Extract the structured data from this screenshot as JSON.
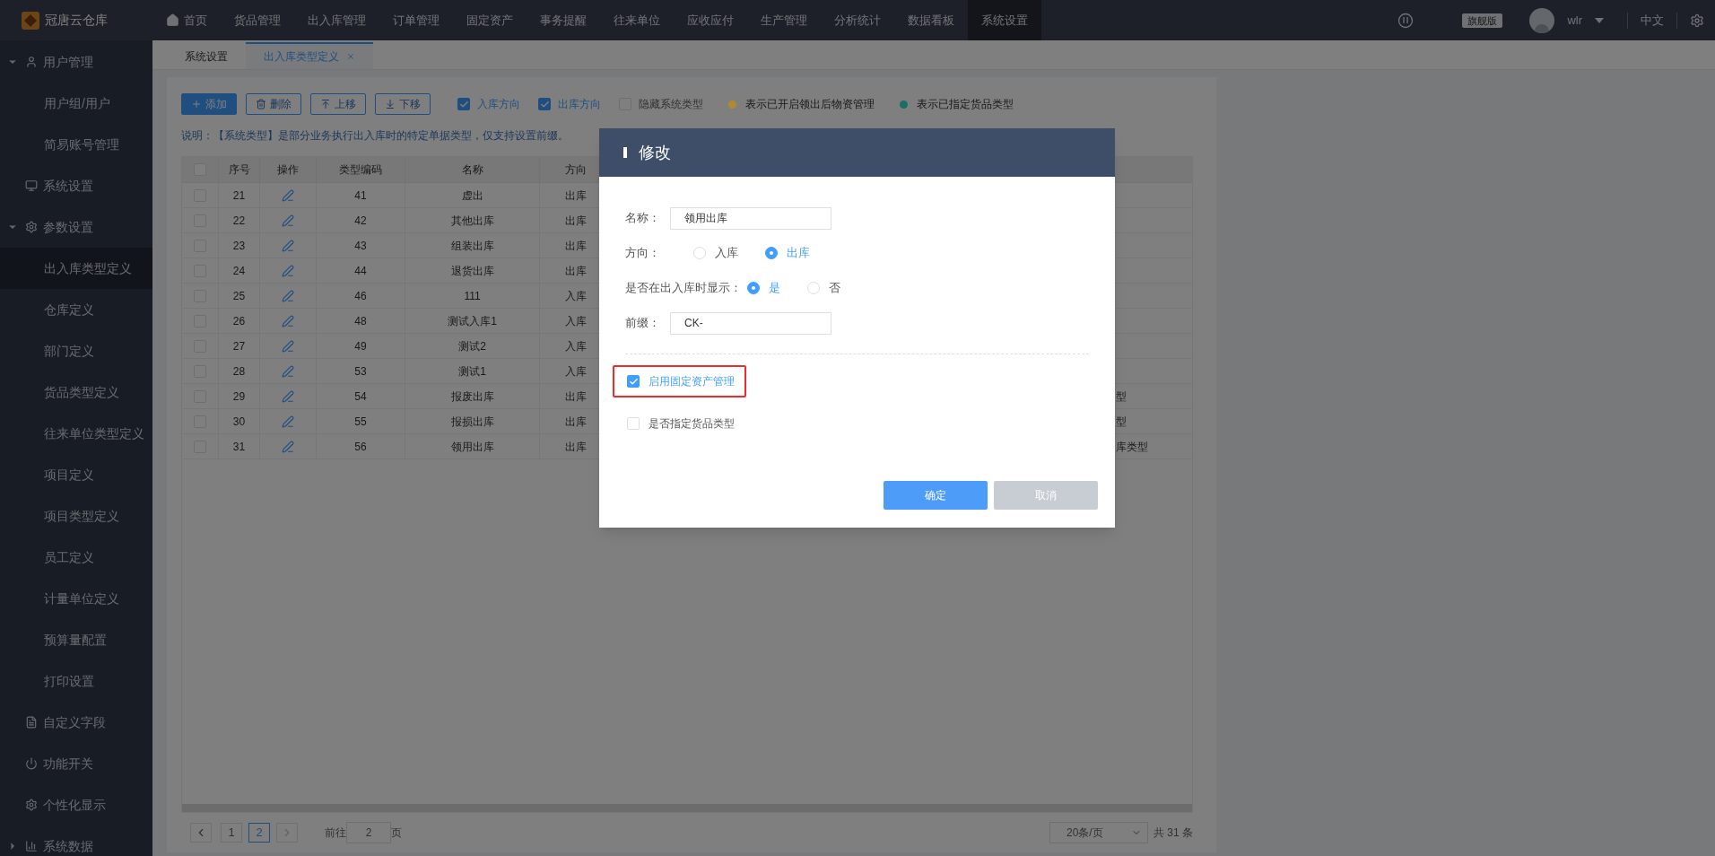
{
  "app": {
    "logo_text": "冠唐云仓库"
  },
  "top_nav": [
    {
      "label": "首页",
      "selected": false
    },
    {
      "label": "货品管理",
      "selected": false
    },
    {
      "label": "出入库管理",
      "selected": false
    },
    {
      "label": "订单管理",
      "selected": false
    },
    {
      "label": "固定资产",
      "selected": false
    },
    {
      "label": "事务提醒",
      "selected": false
    },
    {
      "label": "往来单位",
      "selected": false
    },
    {
      "label": "应收应付",
      "selected": false
    },
    {
      "label": "生产管理",
      "selected": false
    },
    {
      "label": "分析统计",
      "selected": false
    },
    {
      "label": "数据看板",
      "selected": false
    },
    {
      "label": "系统设置",
      "selected": true
    }
  ],
  "user_bar": {
    "edition": "旗舰版",
    "user": "wlr",
    "language": "中文"
  },
  "sidebar": {
    "items": [
      {
        "label": "用户管理",
        "expanded": true,
        "children": [
          {
            "label": "用户组/用户",
            "selected": false
          },
          {
            "label": "简易账号管理",
            "selected": false
          }
        ]
      },
      {
        "label": "系统设置"
      },
      {
        "label": "参数设置",
        "expanded": true,
        "children": [
          {
            "label": "出入库类型定义",
            "selected": true
          },
          {
            "label": "仓库定义",
            "selected": false
          },
          {
            "label": "部门定义",
            "selected": false
          },
          {
            "label": "货品类型定义",
            "selected": false
          },
          {
            "label": "往来单位类型定义",
            "selected": false
          },
          {
            "label": "项目定义",
            "selected": false
          },
          {
            "label": "项目类型定义",
            "selected": false
          },
          {
            "label": "员工定义",
            "selected": false
          },
          {
            "label": "计量单位定义",
            "selected": false
          },
          {
            "label": "预算量配置",
            "selected": false
          },
          {
            "label": "打印设置",
            "selected": false
          }
        ]
      },
      {
        "label": "自定义字段"
      },
      {
        "label": "功能开关"
      },
      {
        "label": "个性化显示"
      },
      {
        "label": "系统数据",
        "expanded": false
      }
    ]
  },
  "tabs": [
    {
      "label": "系统设置",
      "selected": false
    },
    {
      "label": "出入库类型定义",
      "selected": true
    }
  ],
  "toolbar": {
    "buttons": [
      {
        "label": "添加",
        "kind": "primary"
      },
      {
        "label": "删除",
        "kind": "plain"
      },
      {
        "label": "上移",
        "kind": "plain"
      },
      {
        "label": "下移",
        "kind": "plain"
      }
    ],
    "filters": [
      {
        "label": "入库方向",
        "checked": true
      },
      {
        "label": "出库方向",
        "checked": true
      },
      {
        "label": "隐藏系统类型",
        "checked": false
      }
    ],
    "legend": [
      {
        "label": "表示已开启领出后物资管理",
        "color": "#b08a2e"
      },
      {
        "label": "表示已指定货品类型",
        "color": "#1b6e64"
      }
    ]
  },
  "note": "说明：【系统类型】是部分业务执行出入库时的特定单据类型，仅支持设置前缀。",
  "table": {
    "all_checked": false,
    "columns": [
      "序号",
      "操作",
      "类型编码",
      "名称",
      "方向"
    ],
    "rows": [
      {
        "seq": "21",
        "code": "41",
        "name": "虚出",
        "direction": "出库",
        "checked": false
      },
      {
        "seq": "22",
        "code": "42",
        "name": "其他出库",
        "direction": "出库",
        "checked": false
      },
      {
        "seq": "23",
        "code": "43",
        "name": "组装出库",
        "direction": "出库",
        "checked": false
      },
      {
        "seq": "24",
        "code": "44",
        "name": "退货出库",
        "direction": "出库",
        "checked": false
      },
      {
        "seq": "25",
        "code": "46",
        "name": "111",
        "direction": "入库",
        "checked": false
      },
      {
        "seq": "26",
        "code": "48",
        "name": "测试入库1",
        "direction": "入库",
        "checked": false
      },
      {
        "seq": "27",
        "code": "49",
        "name": "测试2",
        "direction": "入库",
        "checked": false
      },
      {
        "seq": "28",
        "code": "53",
        "name": "测试1",
        "direction": "入库",
        "checked": false
      },
      {
        "seq": "29",
        "code": "54",
        "name": "报废出库",
        "direction": "出库",
        "checked": false,
        "column_6": "型"
      },
      {
        "seq": "30",
        "code": "55",
        "name": "报损出库",
        "direction": "出库",
        "checked": false,
        "column_6": "型"
      },
      {
        "seq": "31",
        "code": "56",
        "name": "领用出库",
        "direction": "出库",
        "checked": false,
        "column_6": "库类型"
      }
    ]
  },
  "pagination": {
    "pages": [
      {
        "label": "1",
        "selected": false
      },
      {
        "label": "2",
        "selected": true
      }
    ],
    "goto_label": "前往",
    "goto_value": "2",
    "goto_suffix": "页",
    "page_size": "20条/页",
    "total": "共 31 条"
  },
  "dialog": {
    "title": "修改",
    "name_label": "名称：",
    "name_value": "领用出库",
    "direction_label": "方向：",
    "direction_options": [
      {
        "label": "入库",
        "selected": false
      },
      {
        "label": "出库",
        "selected": true
      }
    ],
    "show_label": "是否在出入库时显示：",
    "show_options": [
      {
        "label": "是",
        "selected": true
      },
      {
        "label": "否",
        "selected": false
      }
    ],
    "prefix_label": "前缀：",
    "prefix_value": "CK-",
    "options": [
      {
        "label": "启用固定资产管理",
        "checked": true,
        "highlighted": true
      },
      {
        "label": "是否指定货品类型",
        "checked": false,
        "highlighted": false
      }
    ],
    "buttons": [
      {
        "label": "确定",
        "kind": "primary"
      },
      {
        "label": "取消",
        "kind": "disabled"
      }
    ]
  }
}
